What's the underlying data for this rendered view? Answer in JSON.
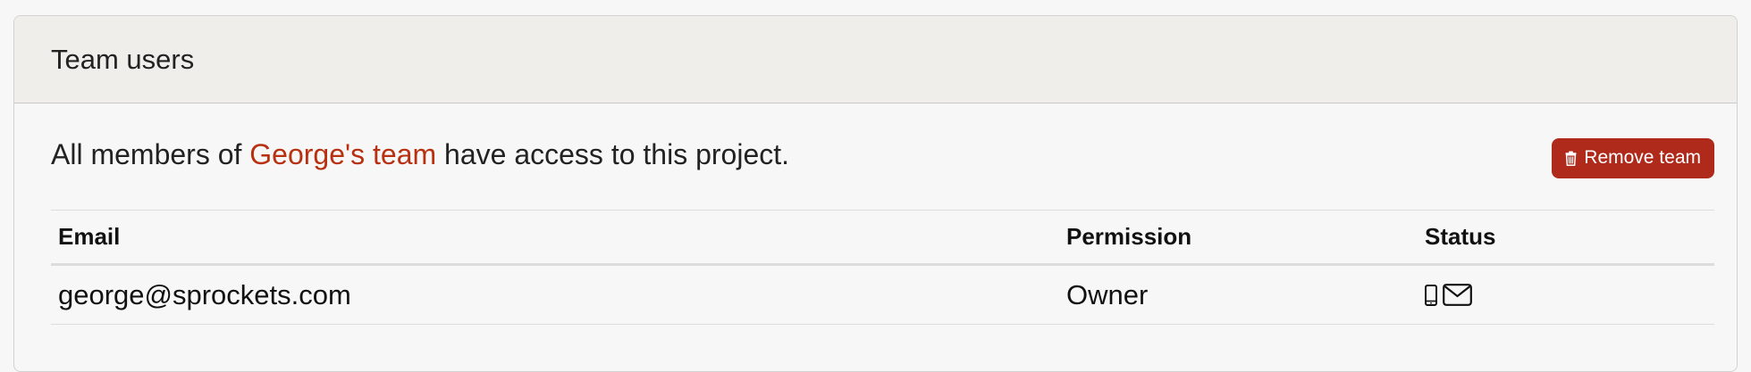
{
  "panel": {
    "title": "Team users"
  },
  "intro": {
    "prefix": "All members of ",
    "team_name": "George's team",
    "suffix": " have access to this project."
  },
  "actions": {
    "remove_team_label": "Remove team",
    "remove_team_icon": "trash-icon",
    "accent_color": "#b02a1c",
    "link_color": "#b8300f"
  },
  "table": {
    "columns": [
      "Email",
      "Permission",
      "Status"
    ],
    "rows": [
      {
        "email": "george@sprockets.com",
        "permission": "Owner",
        "status_icons": [
          "mobile-phone-icon",
          "envelope-icon"
        ]
      }
    ]
  }
}
